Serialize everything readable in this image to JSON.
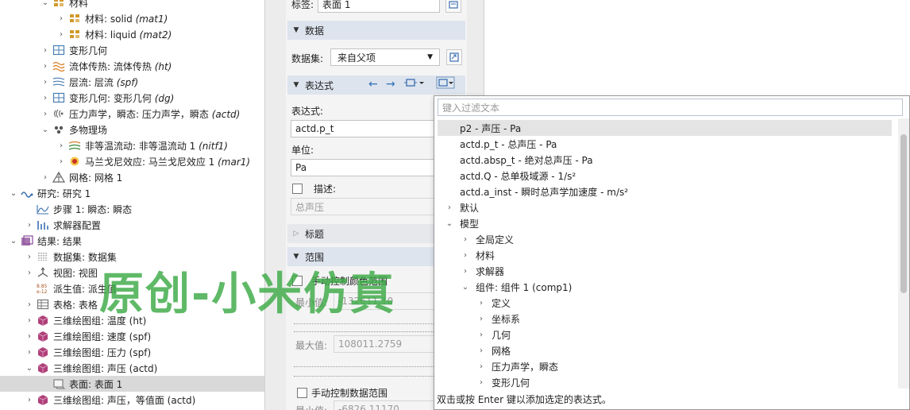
{
  "tree": {
    "items": [
      {
        "indent": 2,
        "twisty": "open",
        "icon": "materials-icon",
        "color": "#d19a2a",
        "label": "材料",
        "tag": ""
      },
      {
        "indent": 3,
        "twisty": "closed",
        "icon": "material-icon",
        "color": "#d19a2a",
        "label": "材料: solid ",
        "tag": "(mat1)"
      },
      {
        "indent": 3,
        "twisty": "closed",
        "icon": "material-icon",
        "color": "#d19a2a",
        "label": "材料: liquid ",
        "tag": "(mat2)"
      },
      {
        "indent": 2,
        "twisty": "closed",
        "icon": "deformed-geometry-icon",
        "color": "#4a7fb5",
        "label": "变形几何",
        "tag": ""
      },
      {
        "indent": 2,
        "twisty": "closed",
        "icon": "heat-transfer-icon",
        "color": "#d9822b",
        "label": "流体传热: 流体传热 ",
        "tag": "(ht)"
      },
      {
        "indent": 2,
        "twisty": "closed",
        "icon": "laminar-flow-icon",
        "color": "#4a7fb5",
        "label": "层流: 层流 ",
        "tag": "(spf)"
      },
      {
        "indent": 2,
        "twisty": "closed",
        "icon": "deformed-geometry-icon",
        "color": "#4a7fb5",
        "label": "变形几何: 变形几何 ",
        "tag": "(dg)"
      },
      {
        "indent": 2,
        "twisty": "closed",
        "icon": "pressure-acoustics-icon",
        "color": "#666666",
        "label": "压力声学，瞬态: 压力声学，瞬态 ",
        "tag": "(actd)"
      },
      {
        "indent": 2,
        "twisty": "open",
        "icon": "multiphysics-icon",
        "color": "#555555",
        "label": "多物理场",
        "tag": ""
      },
      {
        "indent": 3,
        "twisty": "closed",
        "icon": "nonisothermal-flow-icon",
        "color": "#3a8a3a",
        "label": "非等温流动: 非等温流动 1 ",
        "tag": "(nitf1)"
      },
      {
        "indent": 3,
        "twisty": "closed",
        "icon": "marangoni-icon",
        "color": "#cc3322",
        "label": "马兰戈尼效应: 马兰戈尼效应 1 ",
        "tag": "(mar1)"
      },
      {
        "indent": 2,
        "twisty": "closed",
        "icon": "mesh-icon",
        "color": "#666666",
        "label": "网格: 网格 1",
        "tag": ""
      },
      {
        "indent": 0,
        "twisty": "open",
        "icon": "study-icon",
        "color": "#3a6fb0",
        "label": "研究: 研究 1",
        "tag": ""
      },
      {
        "indent": 1,
        "twisty": "none",
        "icon": "step-icon",
        "color": "#3a6fb0",
        "label": "步骤 1: 瞬态: 瞬态",
        "tag": ""
      },
      {
        "indent": 1,
        "twisty": "closed",
        "icon": "solver-config-icon",
        "color": "#3a6fb0",
        "label": "求解器配置",
        "tag": ""
      },
      {
        "indent": 0,
        "twisty": "open",
        "icon": "results-icon",
        "color": "#8a4a9a",
        "label": "结果: 结果",
        "tag": ""
      },
      {
        "indent": 1,
        "twisty": "closed",
        "icon": "datasets-icon",
        "color": "#777777",
        "label": "数据集: 数据集",
        "tag": ""
      },
      {
        "indent": 1,
        "twisty": "closed",
        "icon": "views-icon",
        "color": "#555555",
        "label": "视图: 视图",
        "tag": ""
      },
      {
        "indent": 1,
        "twisty": "none",
        "icon": "derived-values-icon",
        "color": "#aa5522",
        "label": "派生值: 派生值",
        "tag": ""
      },
      {
        "indent": 1,
        "twisty": "closed",
        "icon": "tables-icon",
        "color": "#777777",
        "label": "表格: 表格",
        "tag": ""
      },
      {
        "indent": 1,
        "twisty": "closed",
        "icon": "plot-group-3d-icon",
        "color": "#b0407a",
        "label": "三维绘图组: 温度 (ht)",
        "tag": ""
      },
      {
        "indent": 1,
        "twisty": "closed",
        "icon": "plot-group-3d-icon",
        "color": "#b0407a",
        "label": "三维绘图组: 速度 (spf)",
        "tag": ""
      },
      {
        "indent": 1,
        "twisty": "closed",
        "icon": "plot-group-3d-icon",
        "color": "#b0407a",
        "label": "三维绘图组: 压力 (spf)",
        "tag": ""
      },
      {
        "indent": 1,
        "twisty": "open",
        "icon": "plot-group-3d-icon",
        "color": "#b0407a",
        "label": "三维绘图组: 声压 (actd)",
        "tag": ""
      },
      {
        "indent": 2,
        "twisty": "none",
        "icon": "surface-plot-icon",
        "color": "#777777",
        "label": "表面: 表面 1",
        "tag": "",
        "selected": true
      },
      {
        "indent": 1,
        "twisty": "closed",
        "icon": "plot-group-3d-icon",
        "color": "#b0407a",
        "label": "三维绘图组: 声压，等值面 (actd)",
        "tag": ""
      }
    ]
  },
  "settings": {
    "label_caption": "标签:",
    "label_value": "表面 1",
    "data_section": "数据",
    "dataset_caption": "数据集:",
    "dataset_value": "来自父项",
    "expr_section": "表达式",
    "expr_caption": "表达式:",
    "expr_value": "actd.p_t",
    "unit_caption": "单位:",
    "unit_value": "Pa",
    "desc_caption": "描述:",
    "desc_value": "总声压",
    "title_section": "标题",
    "range_section": "范围",
    "manual_color_range": "手动控制颜色范围",
    "min_caption": "最小值:",
    "min_value": "-132611.10",
    "max_caption": "最大值:",
    "max_value": "108011.2759",
    "manual_data_range": "手动控制数据范围",
    "min2_caption": "最小值:",
    "min2_value": "-6826.11170"
  },
  "popup": {
    "filter_placeholder": "键入过滤文本",
    "items": [
      {
        "indent": 0,
        "twisty": "none",
        "label": "p2 - 声压 - Pa",
        "highlight": true
      },
      {
        "indent": 0,
        "twisty": "none",
        "label": "actd.p_t - 总声压 - Pa"
      },
      {
        "indent": 0,
        "twisty": "none",
        "label": "actd.absp_t - 绝对总声压 - Pa"
      },
      {
        "indent": 0,
        "twisty": "none",
        "label": "actd.Q - 总单极域源 - 1/s²"
      },
      {
        "indent": 0,
        "twisty": "none",
        "label": "actd.a_inst - 瞬时总声学加速度 - m/s²"
      },
      {
        "indent": -1,
        "twisty": "closed",
        "label": "默认"
      },
      {
        "indent": -1,
        "twisty": "open",
        "label": "模型"
      },
      {
        "indent": 0,
        "twisty": "closed",
        "label": "全局定义"
      },
      {
        "indent": 0,
        "twisty": "closed",
        "label": "材料"
      },
      {
        "indent": 0,
        "twisty": "closed",
        "label": "求解器"
      },
      {
        "indent": 0,
        "twisty": "open",
        "label": "组件: 组件 1 (comp1)"
      },
      {
        "indent": 1,
        "twisty": "closed",
        "label": "定义"
      },
      {
        "indent": 1,
        "twisty": "closed",
        "label": "坐标系"
      },
      {
        "indent": 1,
        "twisty": "closed",
        "label": "几何"
      },
      {
        "indent": 1,
        "twisty": "closed",
        "label": "网格"
      },
      {
        "indent": 1,
        "twisty": "closed",
        "label": "压力声学，瞬态"
      },
      {
        "indent": 1,
        "twisty": "closed",
        "label": "变形几何"
      }
    ],
    "hint": "双击或按 Enter 键以添加选定的表达式。"
  },
  "watermark": "原创-小米仿真"
}
